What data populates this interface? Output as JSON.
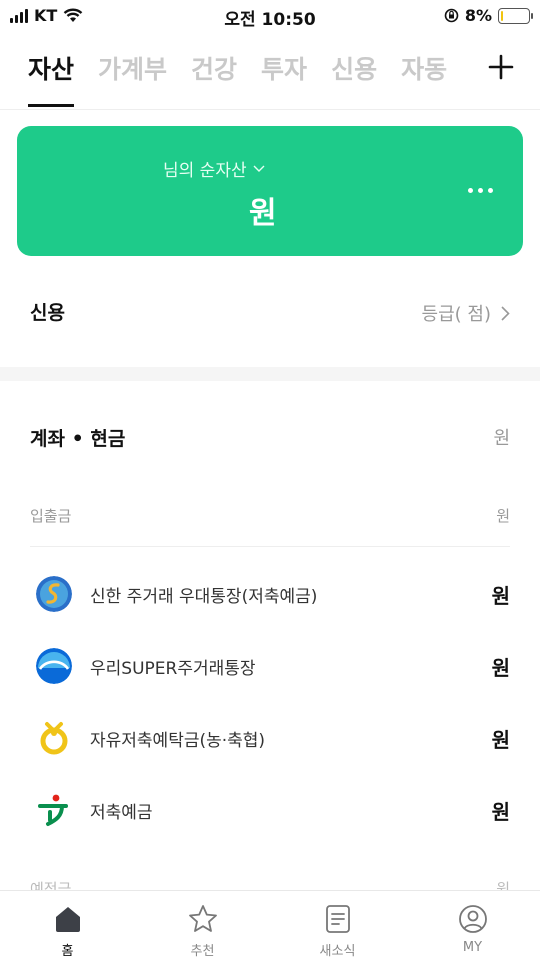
{
  "status_bar": {
    "carrier": "KT",
    "time": "오전 10:50",
    "battery_percent": "8%",
    "battery_level": 0.08,
    "battery_color": "#f1c40f"
  },
  "top_tabs": {
    "items": [
      {
        "label": "자산",
        "active": true
      },
      {
        "label": "가계부",
        "active": false
      },
      {
        "label": "건강",
        "active": false
      },
      {
        "label": "투자",
        "active": false
      },
      {
        "label": "신용",
        "active": false
      },
      {
        "label": "자동",
        "active": false
      }
    ],
    "add_icon": "plus-icon"
  },
  "asset_card": {
    "title": "님의 순자산",
    "amount_unit": "원",
    "color": "#1ecb8a"
  },
  "credit": {
    "label": "신용",
    "value": "등급(    점)"
  },
  "accounts": {
    "header_label": "계좌 • 현금",
    "header_value": "원",
    "sub_label": "입출금",
    "sub_value": "원",
    "items": [
      {
        "name": "신한 주거래 우대통장(저축예금)",
        "amount": "원",
        "logo": "shinhan-logo"
      },
      {
        "name": "우리SUPER주거래통장",
        "amount": "원",
        "logo": "woori-logo"
      },
      {
        "name": "자유저축예탁금(농·축협)",
        "amount": "원",
        "logo": "nonghyup-coop-logo"
      },
      {
        "name": "저축예금",
        "amount": "원",
        "logo": "nonghyup-logo"
      }
    ],
    "peek_label": "예적금",
    "peek_value": "원"
  },
  "bottom_nav": {
    "items": [
      {
        "label": "홈",
        "icon": "home-icon",
        "active": true
      },
      {
        "label": "추천",
        "icon": "star-icon",
        "active": false
      },
      {
        "label": "새소식",
        "icon": "document-icon",
        "active": false
      },
      {
        "label": "MY",
        "icon": "profile-icon",
        "active": false
      }
    ]
  }
}
